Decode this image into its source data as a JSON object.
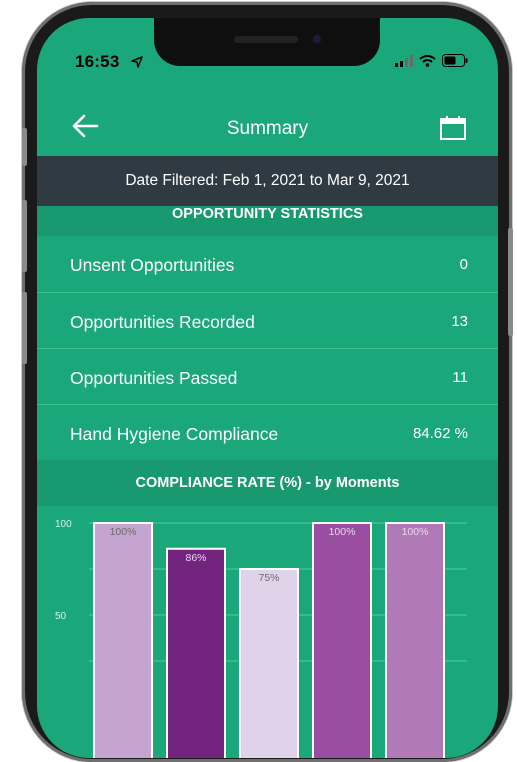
{
  "status_bar": {
    "time": "16:53"
  },
  "nav": {
    "title": "Summary"
  },
  "date_filter": {
    "text": "Date Filtered: Feb 1, 2021 to Mar 9, 2021"
  },
  "opportunity_statistics": {
    "header": "OPPORTUNITY STATISTICS",
    "rows": [
      {
        "label": "Unsent Opportunities",
        "value": "0"
      },
      {
        "label": "Opportunities Recorded",
        "value": "13"
      },
      {
        "label": "Opportunities Passed",
        "value": "11"
      },
      {
        "label": "Hand Hygiene Compliance",
        "value": "84.62 %"
      }
    ]
  },
  "compliance": {
    "header": "COMPLIANCE RATE (%) - by Moments"
  },
  "colors": {
    "primary_green": "#1aa87a",
    "dark_green": "#19996f",
    "date_bar": "#2f3a42",
    "bar_colors": [
      "#c5a5d0",
      "#72247f",
      "#e0d2e8",
      "#9a4ea2",
      "#b17ab7"
    ]
  },
  "chart_data": {
    "type": "bar",
    "title": "COMPLIANCE RATE (%) - by Moments",
    "categories": [
      "",
      "",
      "",
      "",
      ""
    ],
    "values": [
      100,
      86,
      75,
      100,
      100
    ],
    "data_labels": [
      "100%",
      "86%",
      "75%",
      "100%",
      "100%"
    ],
    "y_ticks": [
      "100",
      "50"
    ],
    "ylim": [
      0,
      100
    ],
    "grid": true,
    "legend": "none"
  }
}
